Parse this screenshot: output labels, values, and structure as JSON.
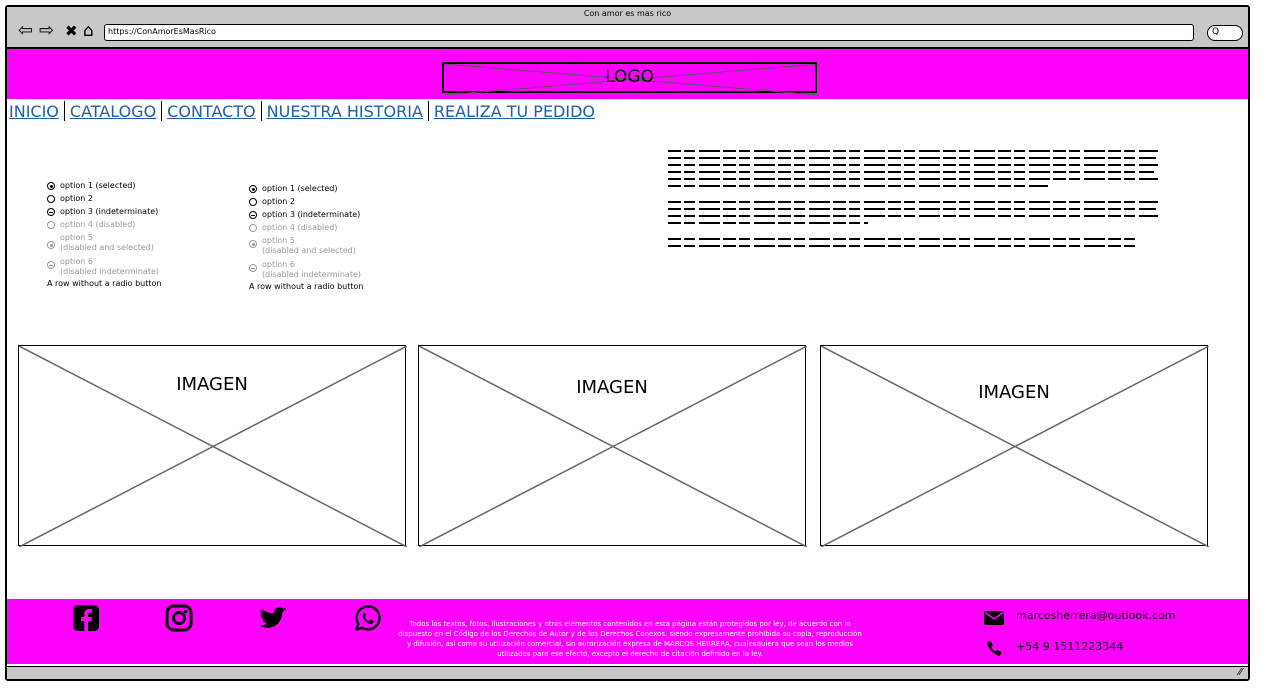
{
  "window": {
    "title": "Con amor es mas rico",
    "url": "https://ConAmorEsMasRico",
    "nav_icons": [
      "back-icon",
      "forward-icon",
      "close-icon",
      "home-icon"
    ],
    "search_label": "Q"
  },
  "header": {
    "logo": "LOGO",
    "background": "#ff00ff"
  },
  "nav": {
    "items": [
      "INICIO",
      "CATALOGO",
      "CONTACTO",
      "NUESTRA HISTORIA",
      "REALIZA TU PEDIDO"
    ],
    "link_color": "#1f5fa8"
  },
  "radio_groups": [
    {
      "options": [
        {
          "label": "option 1 (selected)",
          "state": "selected"
        },
        {
          "label": "option 2",
          "state": "unselected"
        },
        {
          "label": "option 3 (indeterminate)",
          "state": "indeterminate"
        },
        {
          "label": "option 4 (disabled)",
          "state": "disabled"
        },
        {
          "label": "option 5",
          "sublabel": "(disabled and selected)",
          "state": "disabled-selected"
        },
        {
          "label": "option 6",
          "sublabel": "(disabled indeterminate)",
          "state": "disabled-indeterminate"
        }
      ],
      "footer_row": "A row without a radio button"
    },
    {
      "options": [
        {
          "label": "option 1 (selected)",
          "state": "selected"
        },
        {
          "label": "option 2",
          "state": "unselected"
        },
        {
          "label": "option 3 (indeterminate)",
          "state": "indeterminate"
        },
        {
          "label": "option 4 (disabled)",
          "state": "disabled"
        },
        {
          "label": "option 5",
          "sublabel": "(disabled and selected)",
          "state": "disabled-selected"
        },
        {
          "label": "option 6",
          "sublabel": "(disabled indeterminate)",
          "state": "disabled-indeterminate"
        }
      ],
      "footer_row": "A row without a radio button"
    }
  ],
  "images": [
    {
      "label": "IMAGEN"
    },
    {
      "label": "IMAGEN"
    },
    {
      "label": "IMAGEN"
    }
  ],
  "footer": {
    "social_icons": [
      "facebook-icon",
      "instagram-icon",
      "twitter-icon",
      "whatsapp-icon"
    ],
    "legal": "Todos los textos, fotos, ilustraciones y otros elementos contenidos en esta página están protegidos por ley, de acuerdo con lo dispuesto en el Código de los Derechos de Autor y de los Derechos Conexos, siendo expresamente prohibida su copia, reproducción y difusión, así como su utilización comercial, sin autorización expresa de MARCOS HERRERA, cualesquiera que sean los medios utilizados para ese efecto, excepto el derecho de citación definido en la ley.",
    "email": "marcosherrera@outlook.com",
    "phone": "+54 9 1511223344",
    "background": "#ff00ff"
  }
}
